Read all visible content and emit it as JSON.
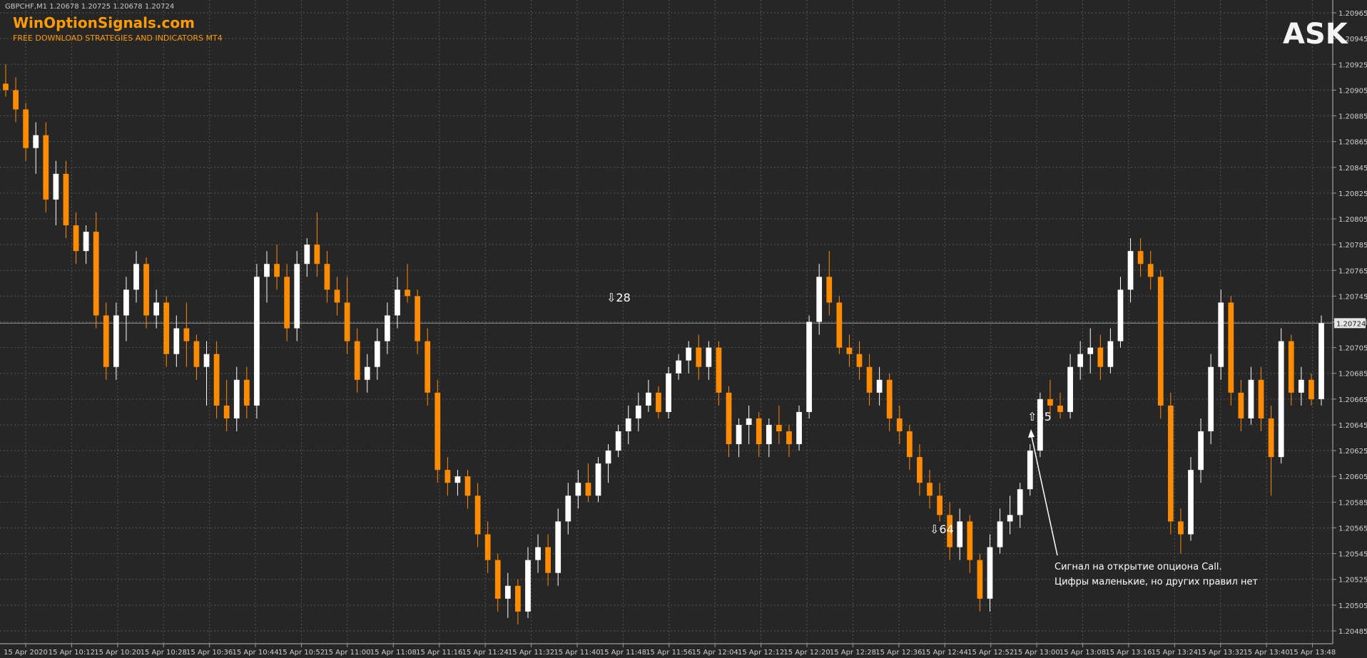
{
  "header": {
    "symbol_line": "GBPCHF,M1  1.20678 1.20725 1.20678 1.20724",
    "brand_title": "WinOptionSignals.com",
    "brand_subtitle": "FREE DOWNLOAD STRATEGIES AND INDICATORS MT4",
    "ask_label": "ASK"
  },
  "chart_data": {
    "type": "candlestick",
    "title": "",
    "xlabel": "",
    "ylabel": "",
    "ylim": [
      1.20475,
      1.20975
    ],
    "x_ticks": [
      "15 Apr 2020",
      "15 Apr 10:12",
      "15 Apr 10:20",
      "15 Apr 10:28",
      "15 Apr 10:36",
      "15 Apr 10:44",
      "15 Apr 10:52",
      "15 Apr 11:00",
      "15 Apr 11:08",
      "15 Apr 11:16",
      "15 Apr 11:24",
      "15 Apr 11:32",
      "15 Apr 11:40",
      "15 Apr 11:48",
      "15 Apr 11:56",
      "15 Apr 12:04",
      "15 Apr 12:12",
      "15 Apr 12:20",
      "15 Apr 12:28",
      "15 Apr 12:36",
      "15 Apr 12:44",
      "15 Apr 12:52",
      "15 Apr 13:00",
      "15 Apr 13:08",
      "15 Apr 13:16",
      "15 Apr 13:24",
      "15 Apr 13:32",
      "15 Apr 13:40",
      "15 Apr 13:48"
    ],
    "y_ticks": [
      "1.20965",
      "1.20945",
      "1.20925",
      "1.20905",
      "1.20885",
      "1.20865",
      "1.20845",
      "1.20825",
      "1.20805",
      "1.20785",
      "1.20765",
      "1.20745",
      "1.20725",
      "1.20705",
      "1.20685",
      "1.20665",
      "1.20645",
      "1.20625",
      "1.20605",
      "1.20585",
      "1.20565",
      "1.20545",
      "1.20525",
      "1.20505",
      "1.20485"
    ],
    "current_price": "1.20724",
    "candles": [
      [
        1.2091,
        1.20925,
        1.209,
        1.20905
      ],
      [
        1.20905,
        1.20915,
        1.2088,
        1.2089
      ],
      [
        1.2089,
        1.20895,
        1.2085,
        1.2086
      ],
      [
        1.2086,
        1.2088,
        1.2084,
        1.2087
      ],
      [
        1.2087,
        1.2088,
        1.2081,
        1.2082
      ],
      [
        1.2082,
        1.2085,
        1.208,
        1.2084
      ],
      [
        1.2084,
        1.2085,
        1.2079,
        1.208
      ],
      [
        1.208,
        1.2081,
        1.2077,
        1.2078
      ],
      [
        1.2078,
        1.208,
        1.2077,
        1.20795
      ],
      [
        1.20795,
        1.2081,
        1.2072,
        1.2073
      ],
      [
        1.2073,
        1.2074,
        1.2068,
        1.2069
      ],
      [
        1.2069,
        1.2074,
        1.2068,
        1.2073
      ],
      [
        1.2073,
        1.2076,
        1.2071,
        1.2075
      ],
      [
        1.2075,
        1.2078,
        1.2074,
        1.2077
      ],
      [
        1.2077,
        1.20775,
        1.2072,
        1.2073
      ],
      [
        1.2073,
        1.2075,
        1.2072,
        1.2074
      ],
      [
        1.2074,
        1.20745,
        1.2069,
        1.207
      ],
      [
        1.207,
        1.2073,
        1.2069,
        1.2072
      ],
      [
        1.2072,
        1.2074,
        1.2069,
        1.2071
      ],
      [
        1.2071,
        1.20715,
        1.2068,
        1.2069
      ],
      [
        1.2069,
        1.2071,
        1.2066,
        1.207
      ],
      [
        1.207,
        1.2071,
        1.2065,
        1.2066
      ],
      [
        1.2066,
        1.2068,
        1.2064,
        1.2065
      ],
      [
        1.2065,
        1.2069,
        1.2064,
        1.2068
      ],
      [
        1.2068,
        1.2069,
        1.2065,
        1.2066
      ],
      [
        1.2066,
        1.2077,
        1.2065,
        1.2076
      ],
      [
        1.2076,
        1.2078,
        1.2074,
        1.2077
      ],
      [
        1.2077,
        1.20785,
        1.2075,
        1.2076
      ],
      [
        1.2076,
        1.2077,
        1.2071,
        1.2072
      ],
      [
        1.2072,
        1.2078,
        1.2071,
        1.2077
      ],
      [
        1.2077,
        1.2079,
        1.2076,
        1.20785
      ],
      [
        1.20785,
        1.2081,
        1.2076,
        1.2077
      ],
      [
        1.2077,
        1.2078,
        1.2074,
        1.2075
      ],
      [
        1.2075,
        1.2076,
        1.2073,
        1.2074
      ],
      [
        1.2074,
        1.2076,
        1.207,
        1.2071
      ],
      [
        1.2071,
        1.2072,
        1.2067,
        1.2068
      ],
      [
        1.2068,
        1.207,
        1.2067,
        1.2069
      ],
      [
        1.2069,
        1.2072,
        1.2068,
        1.2071
      ],
      [
        1.2071,
        1.2074,
        1.207,
        1.2073
      ],
      [
        1.2073,
        1.2076,
        1.2072,
        1.2075
      ],
      [
        1.2075,
        1.2077,
        1.2074,
        1.20745
      ],
      [
        1.20745,
        1.2075,
        1.207,
        1.2071
      ],
      [
        1.2071,
        1.2072,
        1.2066,
        1.2067
      ],
      [
        1.2067,
        1.2068,
        1.206,
        1.2061
      ],
      [
        1.2061,
        1.2062,
        1.2059,
        1.206
      ],
      [
        1.206,
        1.2061,
        1.2059,
        1.20605
      ],
      [
        1.20605,
        1.2061,
        1.2058,
        1.2059
      ],
      [
        1.2059,
        1.206,
        1.2055,
        1.2056
      ],
      [
        1.2056,
        1.2057,
        1.2053,
        1.2054
      ],
      [
        1.2054,
        1.20545,
        1.205,
        1.2051
      ],
      [
        1.2051,
        1.2053,
        1.20495,
        1.2052
      ],
      [
        1.2052,
        1.20525,
        1.2049,
        1.205
      ],
      [
        1.205,
        1.2055,
        1.20495,
        1.2054
      ],
      [
        1.2054,
        1.2056,
        1.2053,
        1.2055
      ],
      [
        1.2055,
        1.2056,
        1.2052,
        1.2053
      ],
      [
        1.2053,
        1.2058,
        1.2052,
        1.2057
      ],
      [
        1.2057,
        1.206,
        1.2056,
        1.2059
      ],
      [
        1.2059,
        1.2061,
        1.2058,
        1.206
      ],
      [
        1.206,
        1.20615,
        1.20585,
        1.2059
      ],
      [
        1.2059,
        1.2062,
        1.20585,
        1.20615
      ],
      [
        1.20615,
        1.2063,
        1.206,
        1.20625
      ],
      [
        1.20625,
        1.20645,
        1.2062,
        1.2064
      ],
      [
        1.2064,
        1.2066,
        1.2063,
        1.2065
      ],
      [
        1.2065,
        1.2067,
        1.2064,
        1.2066
      ],
      [
        1.2066,
        1.2068,
        1.20655,
        1.2067
      ],
      [
        1.2067,
        1.20675,
        1.2065,
        1.20655
      ],
      [
        1.20655,
        1.2069,
        1.2065,
        1.20685
      ],
      [
        1.20685,
        1.207,
        1.2068,
        1.20695
      ],
      [
        1.20695,
        1.2071,
        1.20685,
        1.20705
      ],
      [
        1.20705,
        1.20715,
        1.2068,
        1.2069
      ],
      [
        1.2069,
        1.2071,
        1.2068,
        1.20705
      ],
      [
        1.20705,
        1.2071,
        1.2066,
        1.2067
      ],
      [
        1.2067,
        1.20675,
        1.2062,
        1.2063
      ],
      [
        1.2063,
        1.2065,
        1.2062,
        1.20645
      ],
      [
        1.20645,
        1.2066,
        1.2063,
        1.2065
      ],
      [
        1.2065,
        1.20655,
        1.2062,
        1.2063
      ],
      [
        1.2063,
        1.2065,
        1.2062,
        1.20645
      ],
      [
        1.20645,
        1.2066,
        1.2063,
        1.2064
      ],
      [
        1.2064,
        1.20645,
        1.2062,
        1.2063
      ],
      [
        1.2063,
        1.2066,
        1.20625,
        1.20655
      ],
      [
        1.20655,
        1.2073,
        1.2065,
        1.20725
      ],
      [
        1.20725,
        1.2077,
        1.20715,
        1.2076
      ],
      [
        1.2076,
        1.2078,
        1.2073,
        1.2074
      ],
      [
        1.2074,
        1.20745,
        1.207,
        1.20705
      ],
      [
        1.20705,
        1.20715,
        1.2069,
        1.207
      ],
      [
        1.207,
        1.2071,
        1.2068,
        1.2069
      ],
      [
        1.2069,
        1.207,
        1.2066,
        1.2067
      ],
      [
        1.2067,
        1.2069,
        1.2066,
        1.2068
      ],
      [
        1.2068,
        1.20685,
        1.2064,
        1.2065
      ],
      [
        1.2065,
        1.2066,
        1.2063,
        1.2064
      ],
      [
        1.2064,
        1.20645,
        1.2061,
        1.2062
      ],
      [
        1.2062,
        1.2063,
        1.2059,
        1.206
      ],
      [
        1.206,
        1.2061,
        1.2058,
        1.2059
      ],
      [
        1.2059,
        1.206,
        1.2057,
        1.20575
      ],
      [
        1.20575,
        1.20585,
        1.2054,
        1.2055
      ],
      [
        1.2055,
        1.2058,
        1.2054,
        1.2057
      ],
      [
        1.2057,
        1.20575,
        1.2053,
        1.2054
      ],
      [
        1.2054,
        1.20545,
        1.205,
        1.2051
      ],
      [
        1.2051,
        1.2056,
        1.205,
        1.2055
      ],
      [
        1.2055,
        1.2058,
        1.20545,
        1.2057
      ],
      [
        1.2057,
        1.2059,
        1.2056,
        1.20575
      ],
      [
        1.20575,
        1.206,
        1.20565,
        1.20595
      ],
      [
        1.20595,
        1.2063,
        1.2059,
        1.20625
      ],
      [
        1.20625,
        1.2067,
        1.2062,
        1.20665
      ],
      [
        1.20665,
        1.2068,
        1.2065,
        1.2066
      ],
      [
        1.2066,
        1.2067,
        1.2065,
        1.20655
      ],
      [
        1.20655,
        1.207,
        1.2065,
        1.2069
      ],
      [
        1.2069,
        1.2071,
        1.2068,
        1.207
      ],
      [
        1.207,
        1.2072,
        1.20685,
        1.20705
      ],
      [
        1.20705,
        1.20715,
        1.2068,
        1.2069
      ],
      [
        1.2069,
        1.2072,
        1.20685,
        1.2071
      ],
      [
        1.2071,
        1.2076,
        1.20705,
        1.2075
      ],
      [
        1.2075,
        1.2079,
        1.2074,
        1.2078
      ],
      [
        1.2078,
        1.2079,
        1.2076,
        1.2077
      ],
      [
        1.2077,
        1.2078,
        1.2075,
        1.2076
      ],
      [
        1.2076,
        1.20765,
        1.2065,
        1.2066
      ],
      [
        1.2066,
        1.2067,
        1.2056,
        1.2057
      ],
      [
        1.2057,
        1.2058,
        1.20545,
        1.2056
      ],
      [
        1.2056,
        1.2062,
        1.20555,
        1.2061
      ],
      [
        1.2061,
        1.2065,
        1.206,
        1.2064
      ],
      [
        1.2064,
        1.207,
        1.2063,
        1.2069
      ],
      [
        1.2069,
        1.2075,
        1.2068,
        1.2074
      ],
      [
        1.2074,
        1.20745,
        1.2066,
        1.2067
      ],
      [
        1.2067,
        1.2068,
        1.2064,
        1.2065
      ],
      [
        1.2065,
        1.2069,
        1.20645,
        1.2068
      ],
      [
        1.2068,
        1.2069,
        1.2064,
        1.2065
      ],
      [
        1.2065,
        1.2066,
        1.2059,
        1.2062
      ],
      [
        1.2062,
        1.2072,
        1.20615,
        1.2071
      ],
      [
        1.2071,
        1.20715,
        1.2066,
        1.2067
      ],
      [
        1.2067,
        1.2069,
        1.2066,
        1.2068
      ],
      [
        1.2068,
        1.20685,
        1.2066,
        1.20665
      ],
      [
        1.20665,
        1.2073,
        1.2066,
        1.20724
      ]
    ],
    "signals": [
      {
        "label": "⇩28",
        "direction": "down"
      },
      {
        "label": "⇧35",
        "direction": "up"
      },
      {
        "label": "⇩64",
        "direction": "down"
      }
    ],
    "annotation": {
      "line1": "Сигнал на открытие опциона Call.",
      "line2": "Цифры маленькие, но других правил нет"
    }
  },
  "colors": {
    "background": "#262626",
    "bull": "#ffffff",
    "bear": "#ff8c00",
    "grid": "#555555",
    "axis_text": "#d0d0d0"
  }
}
